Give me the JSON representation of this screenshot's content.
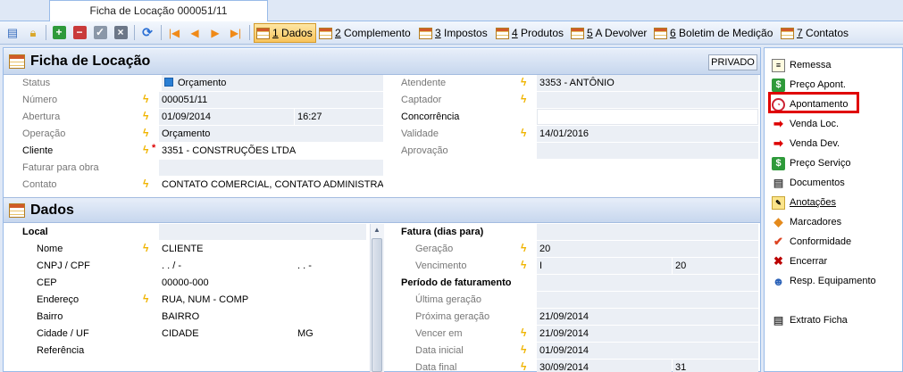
{
  "window": {
    "tab_title": "Ficha de Locação 000051/11"
  },
  "toolbar": {
    "tabs": [
      {
        "num": "1",
        "label": " Dados"
      },
      {
        "num": "2",
        "label": " Complemento"
      },
      {
        "num": "3",
        "label": " Impostos"
      },
      {
        "num": "4",
        "label": " Produtos"
      },
      {
        "num": "5",
        "label": " A Devolver"
      },
      {
        "num": "6",
        "label": " Boletim de Medição"
      },
      {
        "num": "7",
        "label": " Contatos"
      }
    ]
  },
  "ficha": {
    "title": "Ficha de Locação",
    "privado": "PRIVADO",
    "status_label": "Status",
    "status_value": "Orçamento",
    "numero_label": "Número",
    "numero_value": "000051/11",
    "abertura_label": "Abertura",
    "abertura_date": "01/09/2014",
    "abertura_time": "16:27",
    "operacao_label": "Operação",
    "operacao_value": "Orçamento",
    "cliente_label": "Cliente",
    "cliente_value": "3351 - CONSTRUÇÕES LTDA",
    "faturar_label": "Faturar para obra",
    "contato_label": "Contato",
    "contato_value": "CONTATO COMERCIAL, CONTATO ADMINISTRATIV",
    "atendente_label": "Atendente",
    "atendente_value": "3353 - ANTÔNIO",
    "captador_label": "Captador",
    "concorrencia_label": "Concorrência",
    "validade_label": "Validade",
    "validade_value": "14/01/2016",
    "aprovacao_label": "Aprovação"
  },
  "dados": {
    "title": "Dados",
    "local_label": "Local",
    "nome_label": "Nome",
    "nome_value": "CLIENTE",
    "cnpj_label": "CNPJ / CPF",
    "cnpj_value": " .  .  /  -",
    "cpf_value": " .  .  -",
    "cep_label": "CEP",
    "cep_value": "00000-000",
    "endereco_label": "Endereço",
    "endereco_value": "RUA, NUM - COMP",
    "bairro_label": "Bairro",
    "bairro_value": "BAIRRO",
    "cidade_label": "Cidade / UF",
    "cidade_value": "CIDADE",
    "uf_value": "MG",
    "referencia_label": "Referência",
    "fatura_label": "Fatura (dias para)",
    "geracao_label": "Geração",
    "geracao_value": "20",
    "vencimento_label": "Vencimento",
    "vencimento_value": "I",
    "vencimento_days": "20",
    "periodo_label": "Período de faturamento",
    "ultima_label": "Última geração",
    "proxima_label": "Próxima geração",
    "proxima_value": "21/09/2014",
    "vencer_label": "Vencer em",
    "vencer_value": "21/09/2014",
    "inicial_label": "Data inicial",
    "inicial_value": "01/09/2014",
    "final_label": "Data final",
    "final_value": "30/09/2014",
    "final_days": "31"
  },
  "sidebar": {
    "items": [
      {
        "label": "Remessa",
        "icon": "document-icon"
      },
      {
        "label": "Preço Apont.",
        "icon": "dollar-icon"
      },
      {
        "label": "Apontamento",
        "icon": "clock-icon"
      },
      {
        "label": "Venda Loc.",
        "icon": "arrow-doc-icon"
      },
      {
        "label": "Venda Dev.",
        "icon": "arrow-doc-icon"
      },
      {
        "label": "Preço Serviço",
        "icon": "dollar-icon"
      },
      {
        "label": "Documentos",
        "icon": "printer-icon"
      },
      {
        "label": "Anotações",
        "icon": "notes-icon"
      },
      {
        "label": "Marcadores",
        "icon": "tag-icon"
      },
      {
        "label": "Conformidade",
        "icon": "check-icon"
      },
      {
        "label": "Encerrar",
        "icon": "close-icon"
      },
      {
        "label": "Resp. Equipamento",
        "icon": "user-icon"
      },
      {
        "label": "Extrato Ficha",
        "icon": "printer-icon"
      }
    ]
  },
  "colors": {
    "accent": "#f8c45c",
    "highlight": "#e00000",
    "header": "#c7d7ee"
  }
}
